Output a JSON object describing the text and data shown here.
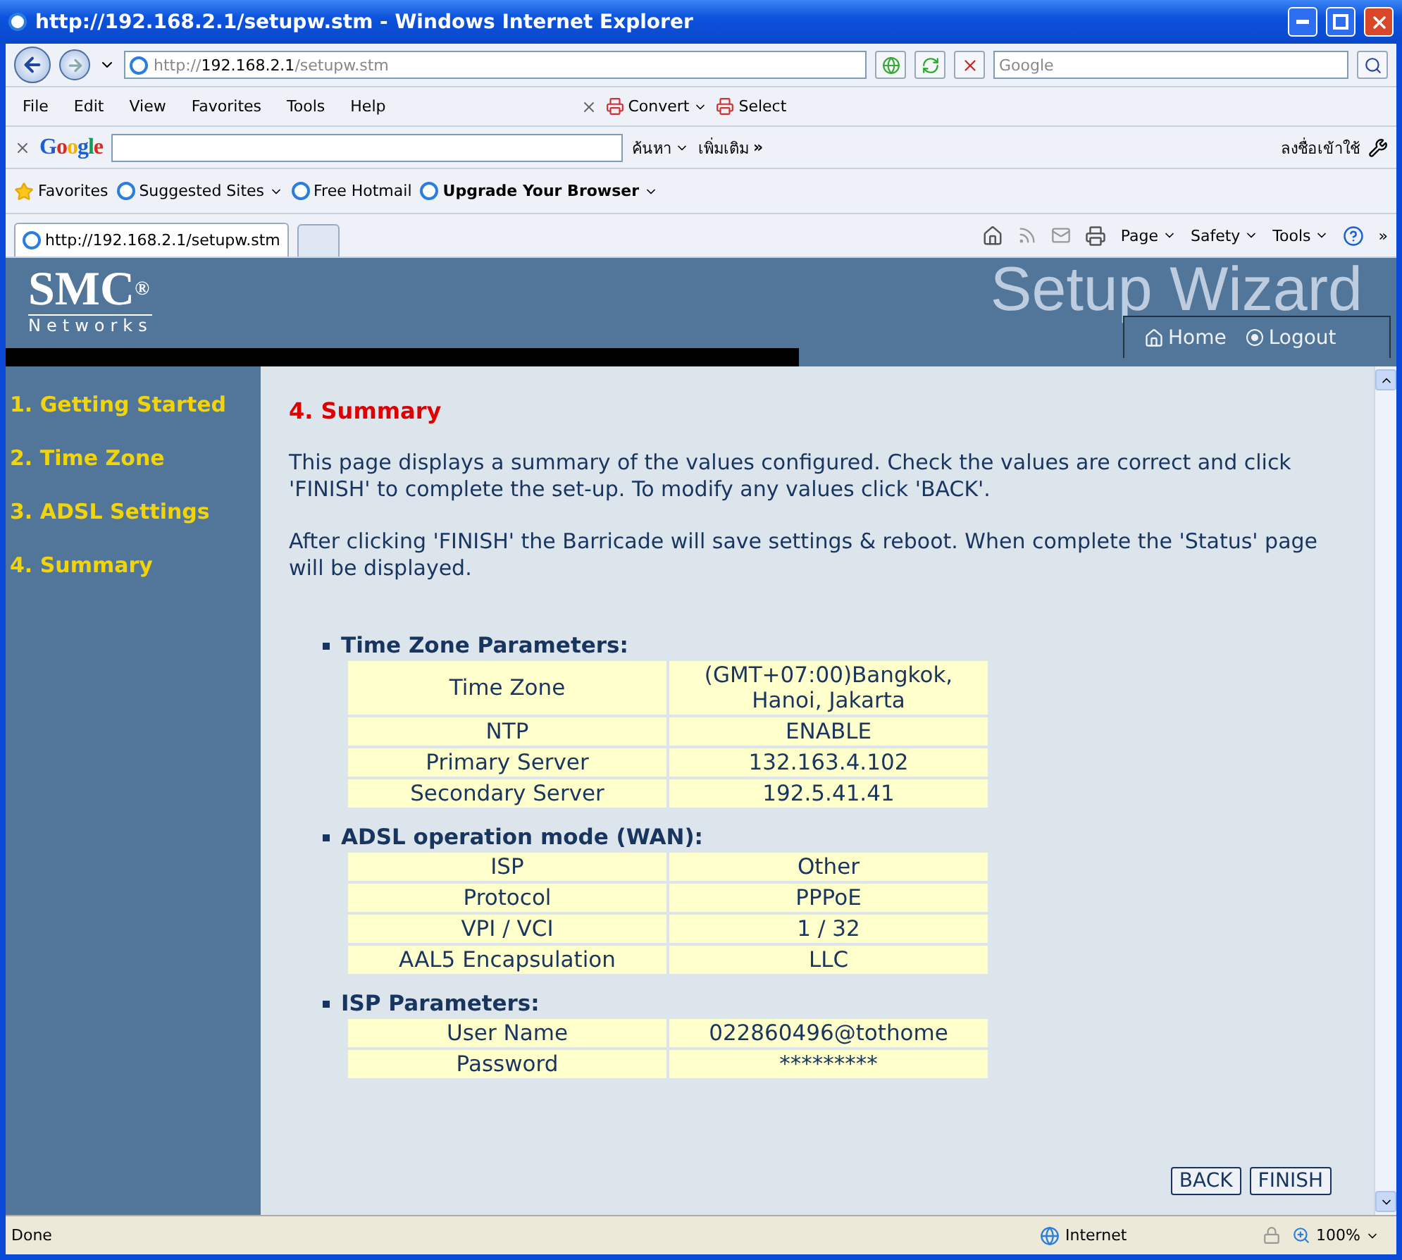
{
  "browser": {
    "title": "http://192.168.2.1/setupw.stm - Windows Internet Explorer",
    "address_prefix": "http://",
    "address_host": "192.168.2.1",
    "address_path": "/setupw.stm",
    "search_placeholder": "Google",
    "menu": [
      "File",
      "Edit",
      "View",
      "Favorites",
      "Tools",
      "Help"
    ],
    "toolbar_buttons": [
      "Convert",
      "Select"
    ],
    "google_toolbar": {
      "logo": "Google",
      "search": "ค้นหา",
      "more": "เพิ่มเติม",
      "more_glyph": "»",
      "signin": "ลงชื่อเข้าใช้"
    },
    "favorites_label": "Favorites",
    "favorites": [
      {
        "label": "Suggested Sites",
        "bold": false,
        "menu": true
      },
      {
        "label": "Free Hotmail",
        "bold": false,
        "menu": false
      },
      {
        "label": "Upgrade Your Browser",
        "bold": true,
        "menu": true
      }
    ],
    "tabs": [
      {
        "title": "http://192.168.2.1/setupw.stm",
        "selected": true
      }
    ],
    "command_bar": [
      "Page",
      "Safety",
      "Tools"
    ],
    "chevron": "»",
    "status": {
      "text": "Done",
      "zone": "Internet",
      "zoom": "100%"
    }
  },
  "page": {
    "logo": {
      "brand": "SMC",
      "reg": "®",
      "sub": "Networks"
    },
    "banner": "Setup Wizard",
    "nav_links": [
      "Home",
      "Logout"
    ],
    "steps": [
      "1. Getting Started",
      "2. Time Zone",
      "3. ADSL Settings",
      "4. Summary"
    ],
    "heading": "4. Summary",
    "paragraphs": [
      "This page displays a summary of the values configured. Check the values are correct and click 'FINISH' to complete the set-up. To modify any values click 'BACK'.",
      "After clicking 'FINISH' the Barricade will save settings & reboot. When complete the 'Status' page will be displayed."
    ],
    "sections": [
      {
        "title": "Time Zone Parameters:",
        "rows": [
          {
            "label": "Time Zone",
            "value": "(GMT+07:00)Bangkok, Hanoi, Jakarta"
          },
          {
            "label": "NTP",
            "value": "ENABLE"
          },
          {
            "label": "Primary Server",
            "value": "132.163.4.102"
          },
          {
            "label": "Secondary Server",
            "value": "192.5.41.41"
          }
        ]
      },
      {
        "title": "ADSL operation mode (WAN):",
        "rows": [
          {
            "label": "ISP",
            "value": "Other"
          },
          {
            "label": "Protocol",
            "value": "PPPoE"
          },
          {
            "label": "VPI / VCI",
            "value": "1 / 32"
          },
          {
            "label": "AAL5 Encapsulation",
            "value": "LLC"
          }
        ]
      },
      {
        "title": "ISP Parameters:",
        "rows": [
          {
            "label": "User Name",
            "value": "022860496@tothome"
          },
          {
            "label": "Password",
            "value": "*********"
          }
        ]
      }
    ],
    "buttons": [
      "BACK",
      "FINISH"
    ]
  }
}
